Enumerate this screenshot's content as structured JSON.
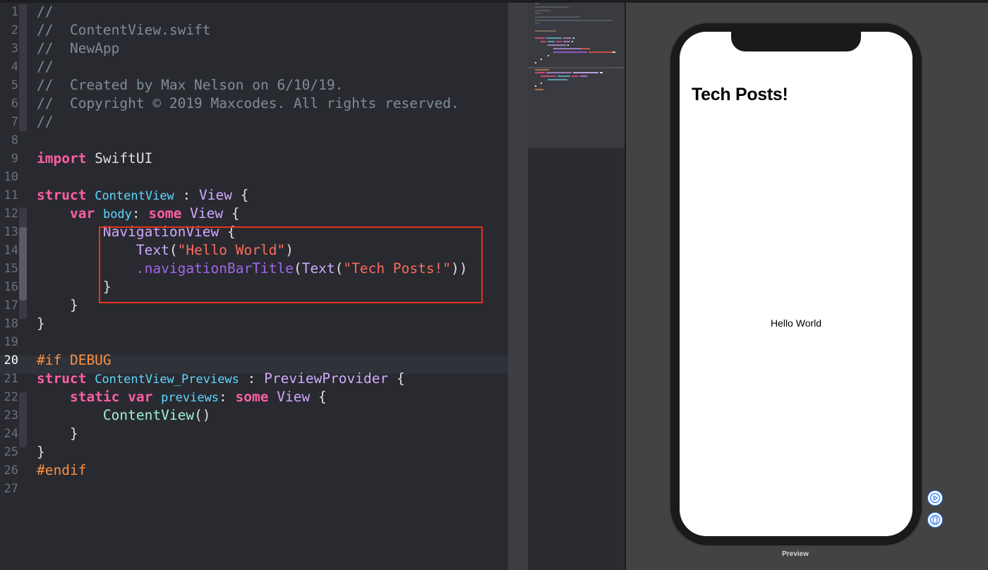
{
  "editor": {
    "line_numbers": [
      "1",
      "2",
      "3",
      "4",
      "5",
      "6",
      "7",
      "8",
      "9",
      "10",
      "11",
      "12",
      "13",
      "14",
      "15",
      "16",
      "17",
      "18",
      "19",
      "20",
      "21",
      "22",
      "23",
      "24",
      "25",
      "26",
      "27"
    ],
    "current_line": "20",
    "lines": [
      [
        {
          "t": "//",
          "c": "comment"
        }
      ],
      [
        {
          "t": "//  ContentView.swift",
          "c": "comment"
        }
      ],
      [
        {
          "t": "//  NewApp",
          "c": "comment"
        }
      ],
      [
        {
          "t": "//",
          "c": "comment"
        }
      ],
      [
        {
          "t": "//  Created by Max Nelson on 6/10/19.",
          "c": "comment"
        }
      ],
      [
        {
          "t": "//  Copyright © 2019 Maxcodes. All rights reserved.",
          "c": "comment"
        }
      ],
      [
        {
          "t": "//",
          "c": "comment"
        }
      ],
      [],
      [
        {
          "t": "import",
          "c": "kw"
        },
        {
          "t": " SwiftUI",
          "c": "plain"
        }
      ],
      [],
      [
        {
          "t": "struct",
          "c": "kw"
        },
        {
          "t": " ",
          "c": "plain"
        },
        {
          "t": "ContentView",
          "c": "decl"
        },
        {
          "t": " : ",
          "c": "plain"
        },
        {
          "t": "View",
          "c": "type"
        },
        {
          "t": " {",
          "c": "plain"
        }
      ],
      [
        {
          "t": "    ",
          "c": "plain"
        },
        {
          "t": "var",
          "c": "kw"
        },
        {
          "t": " ",
          "c": "plain"
        },
        {
          "t": "body",
          "c": "decl"
        },
        {
          "t": ": ",
          "c": "plain"
        },
        {
          "t": "some",
          "c": "kw"
        },
        {
          "t": " ",
          "c": "plain"
        },
        {
          "t": "View",
          "c": "type"
        },
        {
          "t": " {",
          "c": "plain"
        }
      ],
      [
        {
          "t": "        ",
          "c": "plain"
        },
        {
          "t": "NavigationView",
          "c": "type"
        },
        {
          "t": " {",
          "c": "plain"
        }
      ],
      [
        {
          "t": "            ",
          "c": "plain"
        },
        {
          "t": "Text",
          "c": "type"
        },
        {
          "t": "(",
          "c": "plain"
        },
        {
          "t": "\"Hello World\"",
          "c": "str"
        },
        {
          "t": ")",
          "c": "plain"
        }
      ],
      [
        {
          "t": "            ",
          "c": "plain"
        },
        {
          "t": ".navigationBarTitle",
          "c": "method"
        },
        {
          "t": "(",
          "c": "plain"
        },
        {
          "t": "Text",
          "c": "type"
        },
        {
          "t": "(",
          "c": "plain"
        },
        {
          "t": "\"Tech Posts!\"",
          "c": "str"
        },
        {
          "t": "))",
          "c": "plain"
        }
      ],
      [
        {
          "t": "        }",
          "c": "plain"
        }
      ],
      [
        {
          "t": "    }",
          "c": "plain"
        }
      ],
      [
        {
          "t": "}",
          "c": "plain"
        }
      ],
      [],
      [
        {
          "t": "#if DEBUG",
          "c": "pre"
        }
      ],
      [
        {
          "t": "struct",
          "c": "kw"
        },
        {
          "t": " ",
          "c": "plain"
        },
        {
          "t": "ContentView_Previews",
          "c": "decl"
        },
        {
          "t": " : ",
          "c": "plain"
        },
        {
          "t": "PreviewProvider",
          "c": "type"
        },
        {
          "t": " {",
          "c": "plain"
        }
      ],
      [
        {
          "t": "    ",
          "c": "plain"
        },
        {
          "t": "static",
          "c": "kw"
        },
        {
          "t": " ",
          "c": "plain"
        },
        {
          "t": "var",
          "c": "kw"
        },
        {
          "t": " ",
          "c": "plain"
        },
        {
          "t": "previews",
          "c": "decl"
        },
        {
          "t": ": ",
          "c": "plain"
        },
        {
          "t": "some",
          "c": "kw"
        },
        {
          "t": " ",
          "c": "plain"
        },
        {
          "t": "View",
          "c": "type"
        },
        {
          "t": " {",
          "c": "plain"
        }
      ],
      [
        {
          "t": "        ",
          "c": "plain"
        },
        {
          "t": "ContentView",
          "c": "ident"
        },
        {
          "t": "()",
          "c": "plain"
        }
      ],
      [
        {
          "t": "    }",
          "c": "plain"
        }
      ],
      [
        {
          "t": "}",
          "c": "plain"
        }
      ],
      [
        {
          "t": "#endif",
          "c": "pre"
        }
      ],
      []
    ]
  },
  "preview": {
    "nav_title": "Tech Posts!",
    "body_text": "Hello World",
    "label": "Preview",
    "live_preview_icon": "play-circle-icon",
    "device_icon": "device-phone-icon"
  },
  "colors": {
    "highlight_box": "#e2341f",
    "accent_blue": "#2f7bf5"
  }
}
